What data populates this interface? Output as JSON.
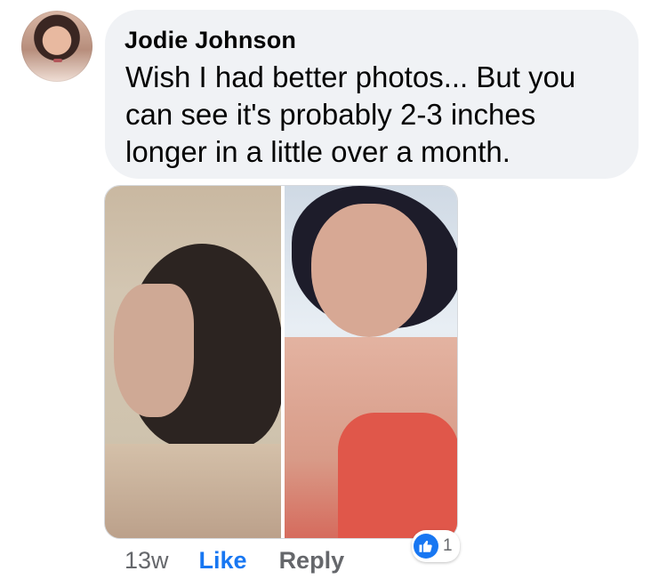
{
  "comment": {
    "author": "Jodie Johnson",
    "text": "Wish I had better photos... But you can see it's probably 2-3 inches longer in a little over a month.",
    "time": "13w",
    "like_label": "Like",
    "reply_label": "Reply",
    "reaction_count": "1",
    "reaction_type": "thumbs-up-icon"
  },
  "colors": {
    "bubble_bg": "#f0f2f5",
    "like_blue": "#1877f2",
    "meta_gray": "#65676b",
    "text": "#050505"
  }
}
